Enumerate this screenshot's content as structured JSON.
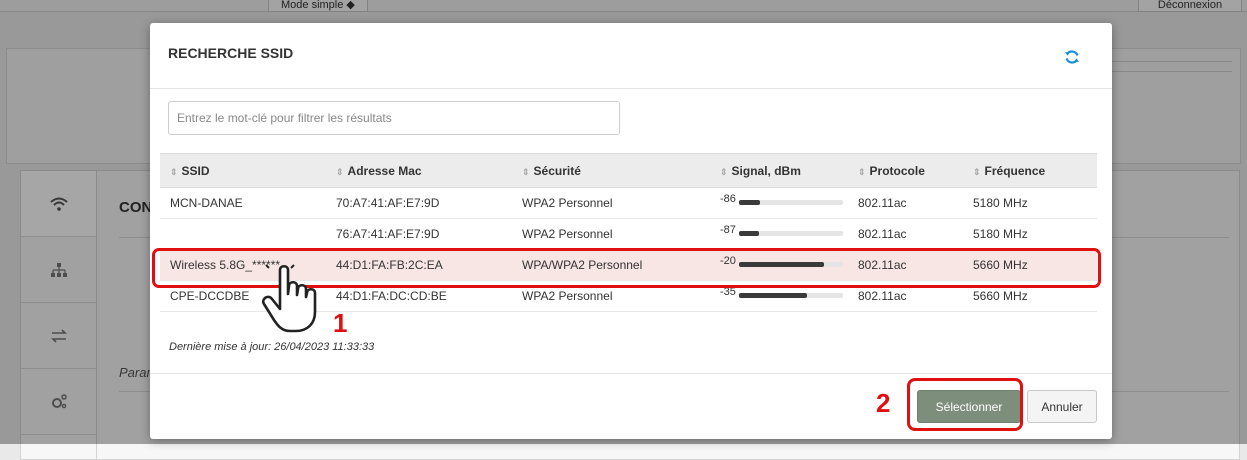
{
  "background": {
    "crumb": "…",
    "mode_button": "Mode simple ◆",
    "logout_button": "Déconnexion",
    "section_title": "CONFI",
    "param_text": "Paramè",
    "sidebar_icons": [
      "wifi-icon",
      "network-icon",
      "transfer-icon",
      "settings-icon"
    ]
  },
  "modal": {
    "title": "RECHERCHE SSID",
    "refresh_icon": "refresh-icon",
    "filter_placeholder": "Entrez le mot-clé pour filtrer les résultats",
    "columns": [
      "SSID",
      "Adresse Mac",
      "Sécurité",
      "Signal, dBm",
      "Protocole",
      "Fréquence"
    ],
    "rows": [
      {
        "ssid": "MCN-DANAE",
        "mac": "70:A7:41:AF:E7:9D",
        "security": "WPA2 Personnel",
        "signal": "-86",
        "signal_level": 0.2,
        "protocol": "802.11ac",
        "frequency": "5180 MHz",
        "selected": false
      },
      {
        "ssid": "",
        "mac": "76:A7:41:AF:E7:9D",
        "security": "WPA2 Personnel",
        "signal": "-87",
        "signal_level": 0.19,
        "protocol": "802.11ac",
        "frequency": "5180 MHz",
        "selected": false
      },
      {
        "ssid": "Wireless 5.8G_******",
        "mac": "44:D1:FA:FB:2C:EA",
        "security": "WPA/WPA2 Personnel",
        "signal": "-20",
        "signal_level": 0.82,
        "protocol": "802.11ac",
        "frequency": "5660 MHz",
        "selected": true
      },
      {
        "ssid": "CPE-DCCDBE",
        "mac": "44:D1:FA:DC:CD:BE",
        "security": "WPA2 Personnel",
        "signal": "-35",
        "signal_level": 0.65,
        "protocol": "802.11ac",
        "frequency": "5660 MHz",
        "selected": false
      }
    ],
    "last_update": "Dernière mise à jour: 26/04/2023 11:33:33",
    "select_button": "Sélectionner",
    "cancel_button": "Annuler"
  },
  "annotations": {
    "step1": "1",
    "step2": "2",
    "highlight_color": "#e01010",
    "pointer_icon": "hand-pointer-icon"
  }
}
